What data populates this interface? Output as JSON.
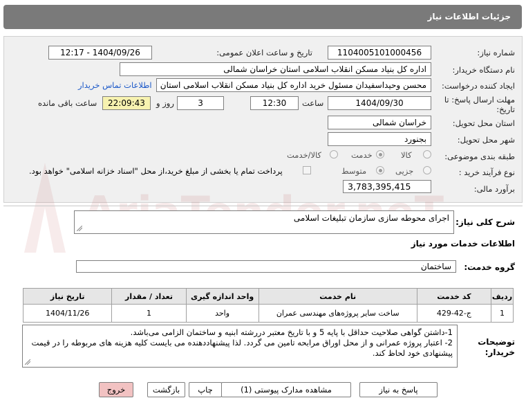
{
  "header": {
    "title": "جزئیات اطلاعات نیاز"
  },
  "labels": {
    "need_number": "شماره نیاز:",
    "public_announce": "تاریخ و ساعت اعلان عمومی:",
    "buyer_org": "نام دستگاه خریدار:",
    "requester": "ایجاد کننده درخواست:",
    "deadline_line1": "مهلت ارسال پاسخ: تا",
    "deadline_line2": "تاریخ:",
    "time_word": "ساعت",
    "day_and": "روز و",
    "remaining": "ساعت باقی مانده",
    "province": "استان محل تحویل:",
    "city": "شهر محل تحویل:",
    "category": "طبقه بندی موضوعی:",
    "process": "نوع فرآیند خرید :",
    "estimate": "برآورد مالی:",
    "description": "شرح کلی نیاز:",
    "services_info": "اطلاعات خدمات مورد نیاز",
    "service_group": "گروه خدمت:",
    "buyer_notes_1": "توضیحات",
    "buyer_notes_2": "خریدار:"
  },
  "values": {
    "need_number": "1104005101000456",
    "public_announce": "1404/09/26 - 12:17",
    "buyer_org": "اداره کل بنیاد مسکن انقلاب اسلامی استان خراسان شمالی",
    "requester": "محسن وحیداسفیدان مسئول خرید اداره کل بنیاد مسکن انقلاب اسلامی استان",
    "contact_link": "اطلاعات تماس خریدار",
    "deadline_date": "1404/09/30",
    "deadline_time": "12:30",
    "days": "3",
    "remaining_time": "22:09:43",
    "province": "خراسان شمالی",
    "city": "بجنورد",
    "estimate": "3,783,395,415",
    "description": "اجرای محوطه سازی سازمان تبلیغات اسلامی",
    "service_group": "ساختمان"
  },
  "category_options": {
    "goods": "کالا",
    "service": "خدمت",
    "goods_service": "کالا/خدمت",
    "selected": "service"
  },
  "process_options": {
    "partial": "جزیی",
    "medium": "متوسط",
    "selected": "medium",
    "treasury_note": "پرداخت تمام یا بخشی از مبلغ خرید،از محل \"اسناد خزانه اسلامی\" خواهد بود."
  },
  "table": {
    "headers": [
      "ردیف",
      "کد خدمت",
      "نام خدمت",
      "واحد اندازه گیری",
      "تعداد / مقدار",
      "تاریخ نیاز"
    ],
    "rows": [
      [
        "1",
        "ج-42-429",
        "ساخت سایر پروژه‌های مهندسی عمران",
        "واحد",
        "1",
        "1404/11/26"
      ]
    ]
  },
  "notes": [
    "1-داشتن گواهی صلاحیت حداقل با پایه 5 و با تاریخ معتبر دررشته ابنیه و ساختمان الزامی می‌باشد.",
    "2- اعتبار پروژه عمرانی و از محل اوراق مرابحه تامین می گردد. لذا پیشنهاددهنده می بایست کلیه هزینه های مربوطه را در قیمت پیشنهادی خود لحاظ کند."
  ],
  "buttons": {
    "reply": "پاسخ به نیاز",
    "attachments": "مشاهده مدارک پیوستی (1)",
    "print": "چاپ",
    "back": "بازگشت",
    "exit": "خروج"
  },
  "watermark": "AriaTender.neT"
}
